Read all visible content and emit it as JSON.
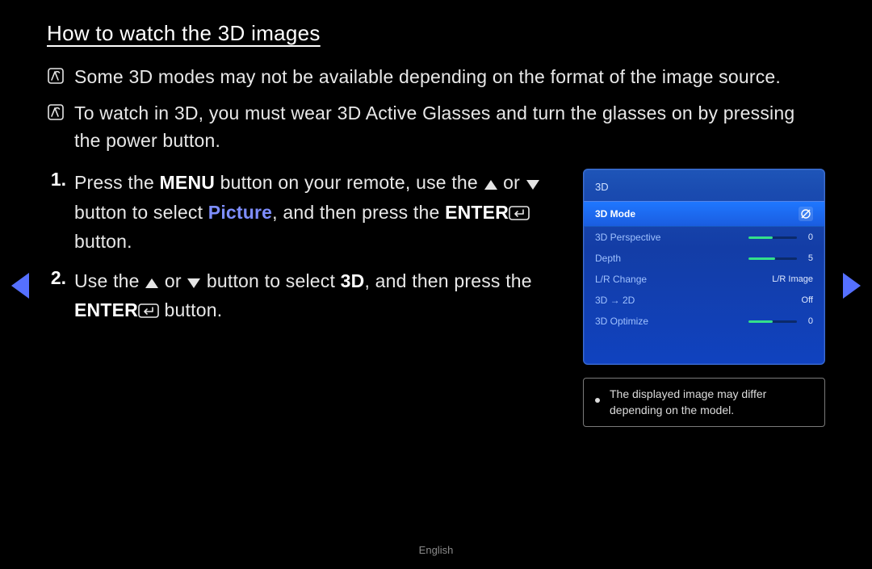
{
  "title": "How to watch the 3D images",
  "notes": [
    "Some 3D modes may not be available depending on the format of the image source.",
    "To watch in 3D, you must wear 3D Active Glasses and turn the glasses on by pressing the power button."
  ],
  "steps": {
    "s1": {
      "num": "1.",
      "pre": "Press the ",
      "menu": "MENU",
      "mid": " button on your remote, use the ",
      "or": " or ",
      "mid2": " button to select ",
      "picture": "Picture",
      "post": ", and then press the ",
      "enter": "ENTER",
      "tail": " button."
    },
    "s2": {
      "num": "2.",
      "pre": "Use the ",
      "or": " or ",
      "mid": " button to select ",
      "threeD": "3D",
      "post": ", and then press the ",
      "enter": "ENTER",
      "tail": " button."
    }
  },
  "osd": {
    "title": "3D",
    "rows": {
      "mode": {
        "label": "3D Mode"
      },
      "perspective": {
        "label": "3D Perspective",
        "value": "0",
        "fillPct": 50
      },
      "depth": {
        "label": "Depth",
        "value": "5",
        "fillPct": 55
      },
      "lrchange": {
        "label": "L/R Change",
        "value": "L/R Image"
      },
      "to2d": {
        "label": "3D → 2D",
        "value": "Off"
      },
      "optimize": {
        "label": "3D Optimize",
        "value": "0",
        "fillPct": 50
      }
    }
  },
  "disclaimer": "The displayed image may differ depending on the model.",
  "footer": "English"
}
